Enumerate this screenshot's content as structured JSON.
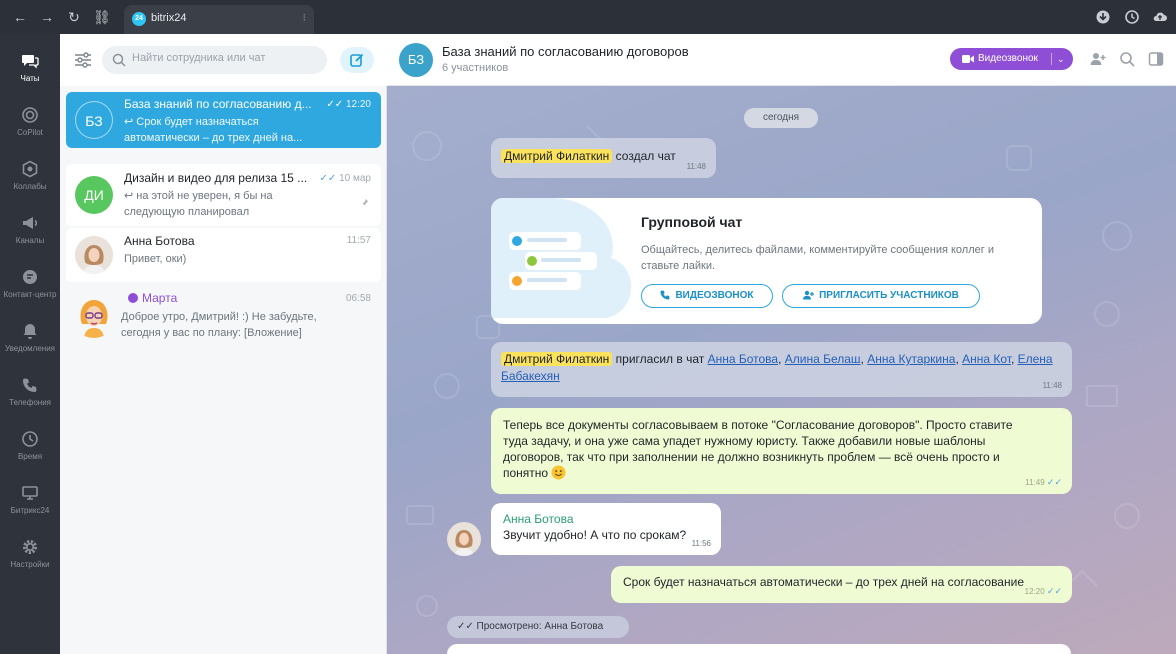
{
  "browser": {
    "tab_title": "bitrix24",
    "tab_logo": "24"
  },
  "rail": {
    "items": [
      {
        "label": "Чаты",
        "icon": "chats-icon"
      },
      {
        "label": "CoPilot",
        "icon": "copilot-icon"
      },
      {
        "label": "Коллабы",
        "icon": "collabs-icon"
      },
      {
        "label": "Каналы",
        "icon": "channels-icon"
      },
      {
        "label": "Контакт-центр",
        "icon": "contact-center-icon"
      },
      {
        "label": "Уведомления",
        "icon": "bell-icon"
      },
      {
        "label": "Телефония",
        "icon": "phone-icon"
      },
      {
        "label": "Время",
        "icon": "clock-icon"
      },
      {
        "label": "Битрикс24",
        "icon": "monitor-icon"
      },
      {
        "label": "Настройки",
        "icon": "gear-icon"
      }
    ]
  },
  "chat_list": {
    "search_placeholder": "Найти сотрудника или чат",
    "items": [
      {
        "initials": "БЗ",
        "title": "База знаний по согласованию д...",
        "time": "12:20",
        "line1": "↩ Срок будет назначаться",
        "line2": "автоматически – до трех дней на..."
      },
      {
        "initials": "ДИ",
        "title": "Дизайн и видео для релиза 15 ...",
        "time": "10 мар",
        "line1": "↩ на этой не уверен, я бы на",
        "line2": "следующую планировал"
      },
      {
        "title": "Анна Ботова",
        "time": "11:57",
        "line1": "Привет, оки)"
      },
      {
        "title": "Марта",
        "time": "06:58",
        "line1": "Доброе утро, Дмитрий! :) Не забудьте,",
        "line2": "сегодня у вас по плану: [Вложение]"
      }
    ]
  },
  "chat": {
    "avatar_initials": "БЗ",
    "title": "База знаний по согласованию договоров",
    "participants": "6 участников",
    "video_call_label": "Видеозвонок",
    "date_label": "сегодня",
    "system_msg_1": {
      "author": "Дмитрий Филаткин",
      "text": "создал чат",
      "time": "11:48"
    },
    "group_card": {
      "title": "Групповой чат",
      "description": "Общайтесь, делитесь файлами, комментируйте сообщения коллег и ставьте лайки.",
      "btn_video": "ВИДЕОЗВОНОК",
      "btn_invite": "ПРИГЛАСИТЬ УЧАСТНИКОВ"
    },
    "system_msg_2": {
      "author": "Дмитрий Филаткин",
      "text": "пригласил в чат",
      "users": [
        "Анна Ботова",
        "Алина Белаш",
        "Анна Кутаркина",
        "Анна Кот",
        "Елена Бабакехян"
      ],
      "time": "11:48"
    },
    "msg_mine_1": {
      "line1": "Теперь все документы согласовываем в потоке \"Согласование договоров\". Просто ставите",
      "line2": "туда задачу, и она уже сама упадет нужному юристу. Также добавили новые шаблоны",
      "line3": "договоров, так что при заполнении не должно возникнуть проблем — всё очень просто и",
      "line4": "понятно",
      "time": "11:49"
    },
    "msg_theirs": {
      "author": "Анна Ботова",
      "text": "Звучит удобно! А что по срокам?",
      "time": "11:56"
    },
    "msg_mine_2": {
      "text": "Срок будет назначаться автоматически – до трех дней на согласование",
      "time": "12:20"
    },
    "seen_label": "Просмотрено: Анна Ботова"
  },
  "colors": {
    "accent": "#2fa8e0",
    "video_button": "#8e4fd6",
    "highlight": "#fbe25c",
    "my_bubble": "#effbd2"
  }
}
